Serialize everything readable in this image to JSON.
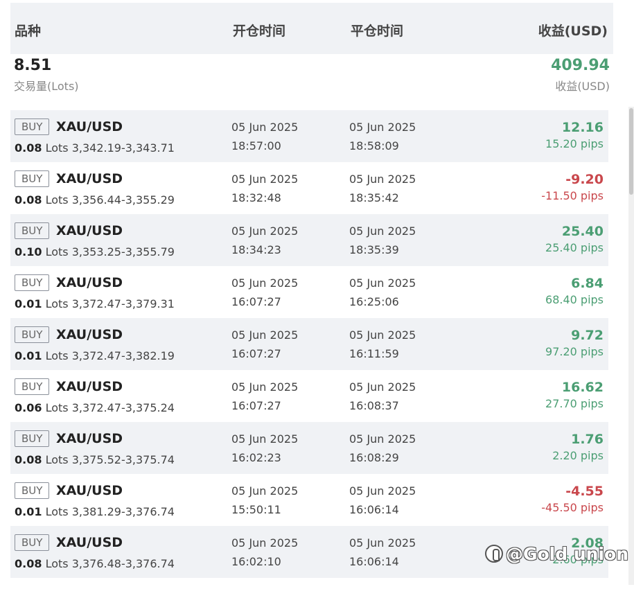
{
  "header": {
    "product": "品种",
    "open_time": "开仓时间",
    "close_time": "平仓时间",
    "profit": "收益(USD)"
  },
  "summary": {
    "volume": "8.51",
    "volume_label": "交易量(Lots)",
    "profit": "409.94",
    "profit_label": "收益(USD)"
  },
  "lots_unit": "Lots",
  "trades": [
    {
      "side": "BUY",
      "symbol": "XAU/USD",
      "lots": "0.08",
      "prices": "3,342.19-3,343.71",
      "open_date": "05 Jun 2025",
      "open_time": "18:57:00",
      "close_date": "05 Jun 2025",
      "close_time": "18:58:09",
      "profit": "12.16",
      "pips": "15.20 pips",
      "status": "pos"
    },
    {
      "side": "BUY",
      "symbol": "XAU/USD",
      "lots": "0.08",
      "prices": "3,356.44-3,355.29",
      "open_date": "05 Jun 2025",
      "open_time": "18:32:48",
      "close_date": "05 Jun 2025",
      "close_time": "18:35:42",
      "profit": "-9.20",
      "pips": "-11.50 pips",
      "status": "neg"
    },
    {
      "side": "BUY",
      "symbol": "XAU/USD",
      "lots": "0.10",
      "prices": "3,353.25-3,355.79",
      "open_date": "05 Jun 2025",
      "open_time": "18:34:23",
      "close_date": "05 Jun 2025",
      "close_time": "18:35:39",
      "profit": "25.40",
      "pips": "25.40 pips",
      "status": "pos"
    },
    {
      "side": "BUY",
      "symbol": "XAU/USD",
      "lots": "0.01",
      "prices": "3,372.47-3,379.31",
      "open_date": "05 Jun 2025",
      "open_time": "16:07:27",
      "close_date": "05 Jun 2025",
      "close_time": "16:25:06",
      "profit": "6.84",
      "pips": "68.40 pips",
      "status": "pos"
    },
    {
      "side": "BUY",
      "symbol": "XAU/USD",
      "lots": "0.01",
      "prices": "3,372.47-3,382.19",
      "open_date": "05 Jun 2025",
      "open_time": "16:07:27",
      "close_date": "05 Jun 2025",
      "close_time": "16:11:59",
      "profit": "9.72",
      "pips": "97.20 pips",
      "status": "pos"
    },
    {
      "side": "BUY",
      "symbol": "XAU/USD",
      "lots": "0.06",
      "prices": "3,372.47-3,375.24",
      "open_date": "05 Jun 2025",
      "open_time": "16:07:27",
      "close_date": "05 Jun 2025",
      "close_time": "16:08:37",
      "profit": "16.62",
      "pips": "27.70 pips",
      "status": "pos"
    },
    {
      "side": "BUY",
      "symbol": "XAU/USD",
      "lots": "0.08",
      "prices": "3,375.52-3,375.74",
      "open_date": "05 Jun 2025",
      "open_time": "16:02:23",
      "close_date": "05 Jun 2025",
      "close_time": "16:08:29",
      "profit": "1.76",
      "pips": "2.20 pips",
      "status": "pos"
    },
    {
      "side": "BUY",
      "symbol": "XAU/USD",
      "lots": "0.01",
      "prices": "3,381.29-3,376.74",
      "open_date": "05 Jun 2025",
      "open_time": "15:50:11",
      "close_date": "05 Jun 2025",
      "close_time": "16:06:14",
      "profit": "-4.55",
      "pips": "-45.50 pips",
      "status": "neg"
    },
    {
      "side": "BUY",
      "symbol": "XAU/USD",
      "lots": "0.08",
      "prices": "3,376.48-3,376.74",
      "open_date": "05 Jun 2025",
      "open_time": "16:02:10",
      "close_date": "05 Jun 2025",
      "close_time": "16:06:14",
      "profit": "2.08",
      "pips": "2.60 pips",
      "status": "pos"
    }
  ],
  "colors": {
    "positive": "#4b9e73",
    "negative": "#c9474c",
    "header_bg": "#f0f2f5"
  },
  "watermark": {
    "text": "@Gold union",
    "icon": "zhihu-logo-icon"
  }
}
